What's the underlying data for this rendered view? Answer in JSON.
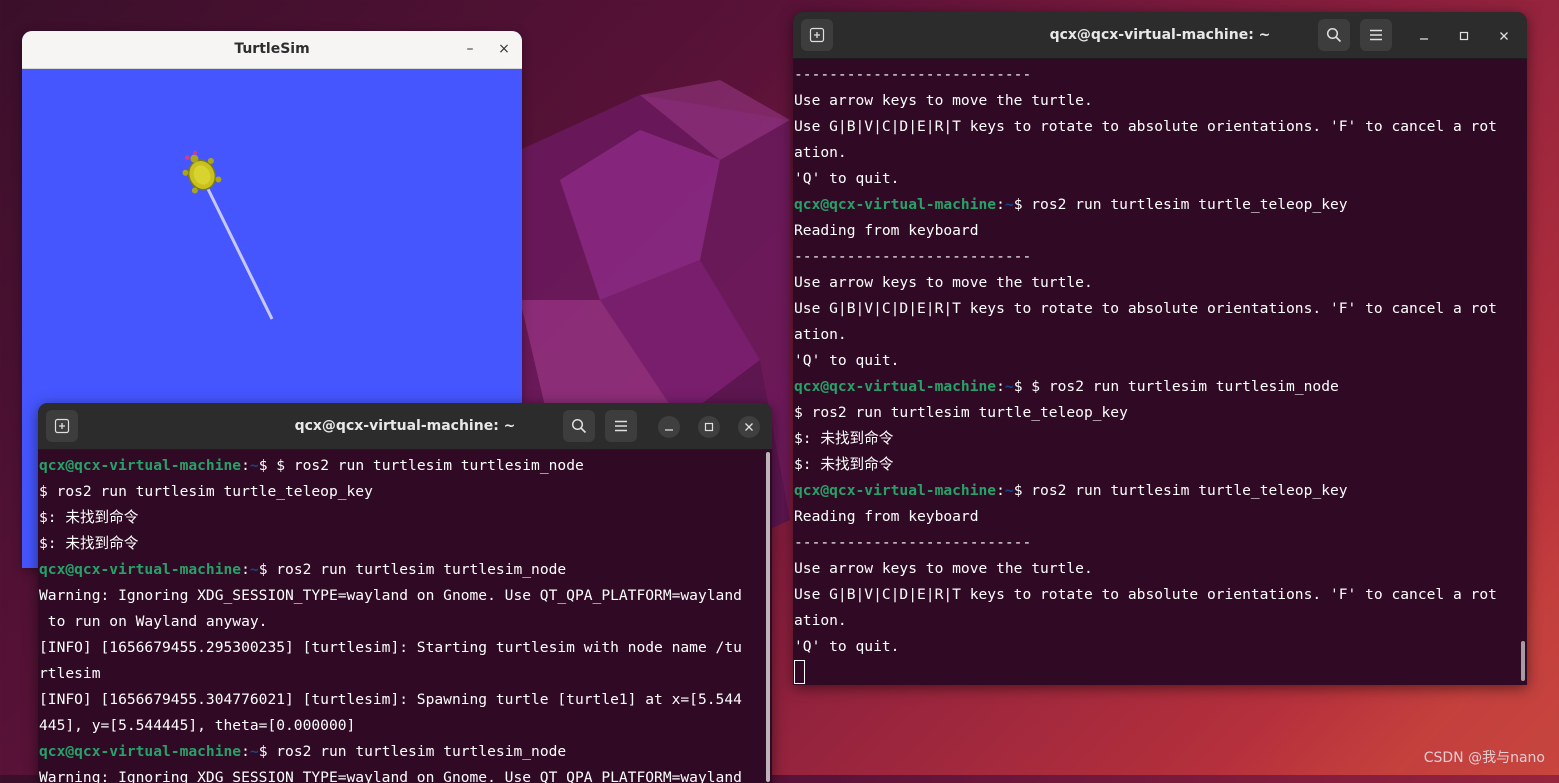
{
  "turtlesim": {
    "title": "TurtleSim",
    "minimize": "–",
    "close": "×",
    "background_color": "#4556ff"
  },
  "terminal_left": {
    "title": "qcx@qcx-virtual-machine: ~",
    "lines": [
      [
        {
          "t": "qcx@qcx-virtual-machine",
          "c": "usr"
        },
        {
          "t": ":",
          "c": ""
        },
        {
          "t": "~",
          "c": "path"
        },
        {
          "t": "$ $ ros2 run turtlesim turtlesim_node",
          "c": ""
        }
      ],
      [
        {
          "t": "$ ros2 run turtlesim turtle_teleop_key",
          "c": ""
        }
      ],
      [
        {
          "t": "$: 未找到命令",
          "c": ""
        }
      ],
      [
        {
          "t": "$: 未找到命令",
          "c": ""
        }
      ],
      [
        {
          "t": "qcx@qcx-virtual-machine",
          "c": "usr"
        },
        {
          "t": ":",
          "c": ""
        },
        {
          "t": "~",
          "c": "path"
        },
        {
          "t": "$ ros2 run turtlesim turtlesim_node",
          "c": ""
        }
      ],
      [
        {
          "t": "Warning: Ignoring XDG_SESSION_TYPE=wayland on Gnome. Use QT_QPA_PLATFORM=wayland",
          "c": ""
        }
      ],
      [
        {
          "t": " to run on Wayland anyway.",
          "c": ""
        }
      ],
      [
        {
          "t": "[INFO] [1656679455.295300235] [turtlesim]: Starting turtlesim with node name /tu",
          "c": ""
        }
      ],
      [
        {
          "t": "rtlesim",
          "c": ""
        }
      ],
      [
        {
          "t": "[INFO] [1656679455.304776021] [turtlesim]: Spawning turtle [turtle1] at x=[5.544",
          "c": ""
        }
      ],
      [
        {
          "t": "445], y=[5.544445], theta=[0.000000]",
          "c": ""
        }
      ],
      [
        {
          "t": "qcx@qcx-virtual-machine",
          "c": "usr"
        },
        {
          "t": ":",
          "c": ""
        },
        {
          "t": "~",
          "c": "path"
        },
        {
          "t": "$ ros2 run turtlesim turtlesim_node",
          "c": ""
        }
      ],
      [
        {
          "t": "Warning: Ignoring XDG_SESSION_TYPE=wayland on Gnome. Use QT_QPA_PLATFORM=wayland",
          "c": ""
        }
      ]
    ]
  },
  "terminal_right": {
    "title": "qcx@qcx-virtual-machine: ~",
    "lines": [
      [
        {
          "t": "---------------------------",
          "c": ""
        }
      ],
      [
        {
          "t": "Use arrow keys to move the turtle.",
          "c": ""
        }
      ],
      [
        {
          "t": "Use G|B|V|C|D|E|R|T keys to rotate to absolute orientations. 'F' to cancel a rot",
          "c": ""
        }
      ],
      [
        {
          "t": "ation.",
          "c": ""
        }
      ],
      [
        {
          "t": "'Q' to quit.",
          "c": ""
        }
      ],
      [
        {
          "t": "qcx@qcx-virtual-machine",
          "c": "usr"
        },
        {
          "t": ":",
          "c": ""
        },
        {
          "t": "~",
          "c": "path"
        },
        {
          "t": "$ ros2 run turtlesim turtle_teleop_key",
          "c": ""
        }
      ],
      [
        {
          "t": "Reading from keyboard",
          "c": ""
        }
      ],
      [
        {
          "t": "---------------------------",
          "c": ""
        }
      ],
      [
        {
          "t": "Use arrow keys to move the turtle.",
          "c": ""
        }
      ],
      [
        {
          "t": "Use G|B|V|C|D|E|R|T keys to rotate to absolute orientations. 'F' to cancel a rot",
          "c": ""
        }
      ],
      [
        {
          "t": "ation.",
          "c": ""
        }
      ],
      [
        {
          "t": "'Q' to quit.",
          "c": ""
        }
      ],
      [
        {
          "t": "qcx@qcx-virtual-machine",
          "c": "usr"
        },
        {
          "t": ":",
          "c": ""
        },
        {
          "t": "~",
          "c": "path"
        },
        {
          "t": "$ $ ros2 run turtlesim turtlesim_node",
          "c": ""
        }
      ],
      [
        {
          "t": "$ ros2 run turtlesim turtle_teleop_key",
          "c": ""
        }
      ],
      [
        {
          "t": "$: 未找到命令",
          "c": ""
        }
      ],
      [
        {
          "t": "$: 未找到命令",
          "c": ""
        }
      ],
      [
        {
          "t": "qcx@qcx-virtual-machine",
          "c": "usr"
        },
        {
          "t": ":",
          "c": ""
        },
        {
          "t": "~",
          "c": "path"
        },
        {
          "t": "$ ros2 run turtlesim turtle_teleop_key",
          "c": ""
        }
      ],
      [
        {
          "t": "Reading from keyboard",
          "c": ""
        }
      ],
      [
        {
          "t": "---------------------------",
          "c": ""
        }
      ],
      [
        {
          "t": "Use arrow keys to move the turtle.",
          "c": ""
        }
      ],
      [
        {
          "t": "Use G|B|V|C|D|E|R|T keys to rotate to absolute orientations. 'F' to cancel a rot",
          "c": ""
        }
      ],
      [
        {
          "t": "ation.",
          "c": ""
        }
      ],
      [
        {
          "t": "'Q' to quit.",
          "c": ""
        }
      ]
    ]
  },
  "watermark": "CSDN @我与nano",
  "colors": {
    "terminal_bg": "#300a24",
    "prompt_user": "#26a269",
    "prompt_path": "#12488b",
    "titlebar_dark": "#2c2c2c"
  }
}
